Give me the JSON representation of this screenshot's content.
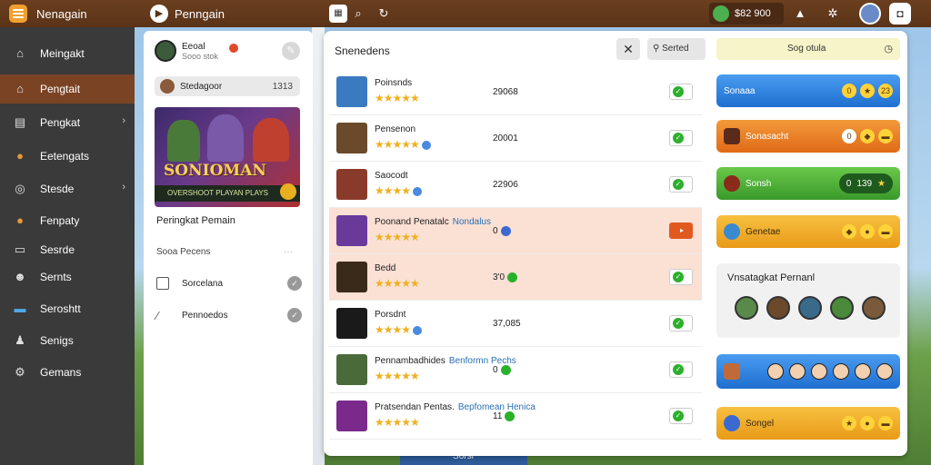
{
  "topbar": {
    "app_name": "Nenagain",
    "page_title": "Penngain",
    "coins": "$82 900",
    "icons": [
      "app-menu-icon",
      "page-badge-icon",
      "grid-icon",
      "pin-icon",
      "refresh-icon",
      "coins-avatar-icon",
      "warning-icon",
      "settings-icon",
      "avatar-icon",
      "bag-icon"
    ]
  },
  "sidebar": {
    "items": [
      {
        "label": "Meingakt",
        "icon": "home-icon"
      },
      {
        "label": "Pengtait",
        "icon": "house-icon",
        "active": true
      },
      {
        "label": "Pengkat",
        "icon": "cards-icon",
        "chevron": true
      },
      {
        "label": "Eetengats",
        "icon": "fire-icon"
      },
      {
        "label": "Stesde",
        "icon": "target-icon",
        "chevron": true
      },
      {
        "label": "Fenpaty",
        "icon": "coin-icon"
      },
      {
        "label": "Sesrde",
        "icon": "monitor-icon"
      },
      {
        "label": "Sernts",
        "icon": "people-icon"
      },
      {
        "label": "Seroshtt",
        "icon": "folder-icon"
      },
      {
        "label": "Senigs",
        "icon": "user-icon"
      },
      {
        "label": "Gemans",
        "icon": "gear-icon"
      }
    ]
  },
  "left_panel": {
    "user_name": "Eeoal",
    "user_sub": "Sooo stok",
    "search_text": "Stedagoor",
    "search_count": "1313",
    "banner_title": "SONIOMAN",
    "banner_sub": "OVERSHOOT PLAYAN PLAYS",
    "heading": "Peringkat Pemain",
    "section": "Sooa Pecens",
    "section_more": "···",
    "options": [
      {
        "label": "Sorcelana",
        "type": "checkbox"
      },
      {
        "label": "Pennoedos",
        "type": "wand"
      }
    ]
  },
  "main": {
    "title": "Snenedens",
    "close": "✕",
    "sort_label": "Serted",
    "status_label": "Sog otula",
    "rows": [
      {
        "name": "Poinsnds",
        "sub": "",
        "stars": "★★★★★",
        "score": "29068",
        "dot": "",
        "check": "green",
        "highlight": false
      },
      {
        "name": "Pensenon",
        "sub": "",
        "stars": "★★★★★",
        "score": "20001",
        "dot": "",
        "check": "green",
        "highlight": false
      },
      {
        "name": "Saocodt",
        "sub": "",
        "stars": "★★★★",
        "score": "22906",
        "dot": "",
        "check": "green",
        "highlight": false
      },
      {
        "name": "Poonand Penatalc",
        "sub": "Nondalus",
        "stars": "★★★★★",
        "score": "0",
        "dot": "blue",
        "check": "orange",
        "highlight": true
      },
      {
        "name": "Bedd",
        "sub": "",
        "stars": "★★★★★",
        "score": "3'0",
        "dot": "green",
        "check": "green",
        "highlight": true
      },
      {
        "name": "Porsdnt",
        "sub": "",
        "stars": "★★★★",
        "score": "37,085",
        "dot": "",
        "check": "green",
        "highlight": false
      },
      {
        "name": "Pennambadhides",
        "sub": "Benformn Pechs",
        "stars": "★★★★★",
        "score": "0",
        "dot": "green",
        "check": "green",
        "highlight": false
      },
      {
        "name": "Pratsendan Pentas.",
        "sub": "Bepfomean Henica",
        "stars": "★★★★★",
        "score": "11",
        "dot": "green",
        "check": "green",
        "highlight": false
      }
    ],
    "cards": [
      {
        "label": "Sonaaa",
        "style": "blue",
        "tokens": [
          "0",
          "23"
        ]
      },
      {
        "label": "Sonasacht",
        "style": "orange",
        "tokens": [
          "0",
          "",
          ""
        ]
      },
      {
        "label": "Sonsh",
        "style": "green",
        "pill": [
          "0",
          "139",
          "★"
        ]
      },
      {
        "label": "Genetae",
        "style": "yellow",
        "tokens": [
          "",
          "",
          ""
        ]
      }
    ],
    "friends_title": "Vnsatagkat Pernanl",
    "team_card": {
      "label": "",
      "style": "blue"
    },
    "last_card": {
      "label": "Songel",
      "style": "yellow",
      "tokens": [
        "",
        "",
        ""
      ]
    }
  },
  "scene": {
    "bottom_label": "Sorsr"
  },
  "colors": {
    "accent": "#7a4424",
    "topbar": "#5a3318",
    "sidebar": "#3a3a3a"
  }
}
